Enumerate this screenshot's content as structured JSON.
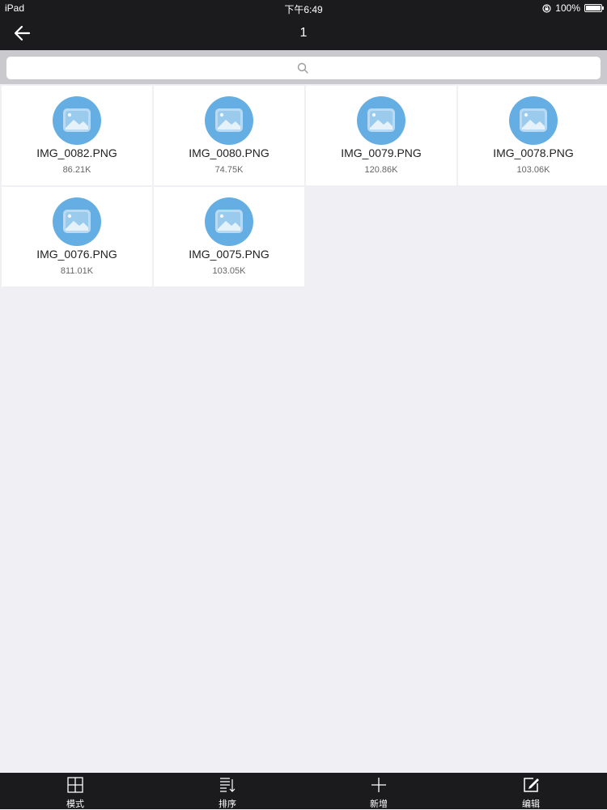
{
  "status_bar": {
    "device": "iPad",
    "time": "下午6:49",
    "battery": "100%",
    "battery_level": 1.0
  },
  "nav": {
    "title": "1"
  },
  "search": {
    "placeholder": ""
  },
  "files": [
    {
      "name": "IMG_0082.PNG",
      "size": "86.21K"
    },
    {
      "name": "IMG_0080.PNG",
      "size": "74.75K"
    },
    {
      "name": "IMG_0079.PNG",
      "size": "120.86K"
    },
    {
      "name": "IMG_0078.PNG",
      "size": "103.06K"
    },
    {
      "name": "IMG_0076.PNG",
      "size": "811.01K"
    },
    {
      "name": "IMG_0075.PNG",
      "size": "103.05K"
    }
  ],
  "toolbar": {
    "mode": "模式",
    "sort": "排序",
    "add": "新增",
    "edit": "编辑"
  },
  "colors": {
    "bar": "#1b1b1d",
    "background": "#efeff4",
    "icon_circle": "#64aee3"
  }
}
